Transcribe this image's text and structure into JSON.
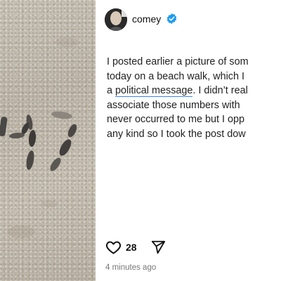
{
  "post": {
    "username": "comey",
    "caption_lines": [
      "I posted earlier a picture of som",
      "today on a beach walk, which I",
      "a ",
      "political message",
      ". I didn’t real",
      "associate those numbers with",
      "never occurred to me but I opp",
      "any kind so I took the post dow"
    ],
    "likes": "28",
    "timestamp": "4 minutes ago"
  },
  "photo": {
    "sand_text": "47"
  },
  "colors": {
    "verified_badge": "#1d9bf0",
    "link_underline": "#3b82f6"
  }
}
